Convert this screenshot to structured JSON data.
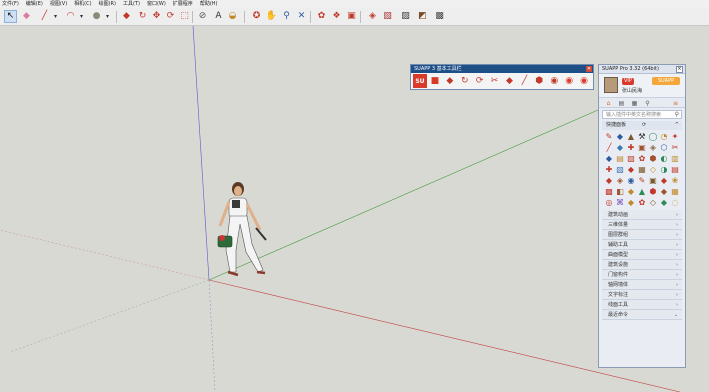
{
  "menubar": {
    "items": [
      "文件(F)",
      "编辑(E)",
      "视图(V)",
      "相机(C)",
      "绘图(R)",
      "工具(T)",
      "窗口(W)",
      "扩展程序",
      "帮助(H)"
    ]
  },
  "toolbar": {
    "buttons": [
      {
        "name": "select-tool",
        "glyph": "↖",
        "color": "#111111",
        "selected": true
      },
      {
        "name": "eraser-tool",
        "glyph": "◆",
        "color": "#e07aa0"
      },
      {
        "name": "line-tool",
        "glyph": "╱",
        "color": "#c0392b"
      },
      {
        "name": "line-dropdown",
        "glyph": "▾",
        "color": "#333333"
      },
      {
        "name": "arc-tool",
        "glyph": "◠",
        "color": "#c0392b"
      },
      {
        "name": "arc-dropdown",
        "glyph": "▾",
        "color": "#333333"
      },
      {
        "name": "shape-tool",
        "glyph": "●",
        "color": "#8a8a7a"
      },
      {
        "name": "shape-dropdown",
        "glyph": "▾",
        "color": "#333333"
      },
      {
        "name": "push-pull-tool",
        "glyph": "◆",
        "color": "#c0392b"
      },
      {
        "name": "offset-tool",
        "glyph": "↻",
        "color": "#c0392b"
      },
      {
        "name": "move-tool",
        "glyph": "✥",
        "color": "#c0392b"
      },
      {
        "name": "rotate-tool",
        "glyph": "⟳",
        "color": "#c0392b"
      },
      {
        "name": "scale-tool",
        "glyph": "⬚",
        "color": "#c0392b"
      },
      {
        "name": "tape-measure-tool",
        "glyph": "⊘",
        "color": "#555555"
      },
      {
        "name": "text-tool",
        "glyph": "A",
        "color": "#333333"
      },
      {
        "name": "paint-bucket-tool",
        "glyph": "◒",
        "color": "#c08a2b"
      },
      {
        "name": "orbit-tool",
        "glyph": "✪",
        "color": "#c0392b"
      },
      {
        "name": "pan-tool",
        "glyph": "✋",
        "color": "#e6c07a"
      },
      {
        "name": "zoom-tool",
        "glyph": "⚲",
        "color": "#2b5aa0"
      },
      {
        "name": "zoom-extents-tool",
        "glyph": "✕",
        "color": "#2b5aa0"
      },
      {
        "name": "warehouse-icon",
        "glyph": "✿",
        "color": "#c0392b"
      },
      {
        "name": "extension-icon",
        "glyph": "❖",
        "color": "#c0392b"
      },
      {
        "name": "components-icon",
        "glyph": "▣",
        "color": "#c0392b"
      },
      {
        "name": "materials-icon",
        "glyph": "◈",
        "color": "#c0392b"
      },
      {
        "name": "layout-icon",
        "glyph": "▧",
        "color": "#a83a3a"
      },
      {
        "name": "style-icon",
        "glyph": "▨",
        "color": "#3a3a3a"
      },
      {
        "name": "scene-icon",
        "glyph": "◩",
        "color": "#7a4a2a"
      },
      {
        "name": "section-icon",
        "glyph": "▩",
        "color": "#4a4a4a"
      }
    ]
  },
  "basic_toolbar": {
    "title": "SUAPP 3 基本工具栏",
    "close": "✕",
    "logo": "SU",
    "buttons": [
      "■",
      "◆",
      "↻",
      "⟳",
      "✂",
      "◆",
      "╱",
      "⬢",
      "◉",
      "◉",
      "◉"
    ]
  },
  "suapp": {
    "title": "SUAPP Pro 3.32 (64bit)",
    "close": "×",
    "vip": "VIP",
    "username": "张山民海",
    "upgrade": "SUAPP",
    "tabs": [
      "⌂",
      "▤",
      "▦",
      "⚲",
      "≡"
    ],
    "search_placeholder": "输入插件中英文名称搜索",
    "quick_panel": "快捷面板",
    "quick_refresh": "⟳",
    "grid_icons": [
      "✎",
      "◆",
      "▲",
      "⚒",
      "◯",
      "◔",
      "✦",
      "╱",
      "◆",
      "✚",
      "▣",
      "◈",
      "⬡",
      "✂",
      "◆",
      "▤",
      "▨",
      "✿",
      "⬢",
      "◐",
      "▥",
      "✚",
      "▧",
      "◆",
      "▦",
      "◇",
      "◑",
      "▤",
      "◆",
      "◈",
      "◉",
      "✎",
      "▣",
      "◆",
      "❀",
      "▩",
      "◧",
      "◆",
      "▲",
      "⬢",
      "◆",
      "▦",
      "◎",
      "⌘",
      "◆",
      "✿",
      "◇",
      "◆",
      "◌"
    ],
    "grid_colors": [
      "#c0392b",
      "#2b5aa0",
      "#7a5a2a",
      "#2b2b2b",
      "#2e8b57",
      "#c08a2b",
      "#c0392b",
      "#c0392b",
      "#3a7ab0",
      "#c0392b",
      "#a0522d",
      "#8a6a4a",
      "#2b5aa0",
      "#c0392b",
      "#2b5aa0",
      "#c08a2b",
      "#c0392b",
      "#c0392b",
      "#a0522d",
      "#2e8b57",
      "#c08a2b",
      "#c0392b",
      "#3a7ab0",
      "#c0392b",
      "#7a5a2a",
      "#c08a2b",
      "#2e8b57",
      "#c0392b",
      "#c0392b",
      "#a0522d",
      "#2b5aa0",
      "#c0392b",
      "#7a5a2a",
      "#c0392b",
      "#c08a2b",
      "#c0392b",
      "#a0522d",
      "#c08a2b",
      "#2e8b57",
      "#c0392b",
      "#a0522d",
      "#c08a2b",
      "#c0392b",
      "#7a4ac0",
      "#c08a2b",
      "#c0392b",
      "#7a5a2a",
      "#2e8b57",
      "#c08a2b"
    ],
    "categories": [
      "建筑动画",
      "三维体量",
      "图层群组",
      "辅助工具",
      "曲面模型",
      "建筑设施",
      "门窗构件",
      "轴网墙体",
      "文字标注",
      "线面工具",
      "最近命令"
    ]
  }
}
